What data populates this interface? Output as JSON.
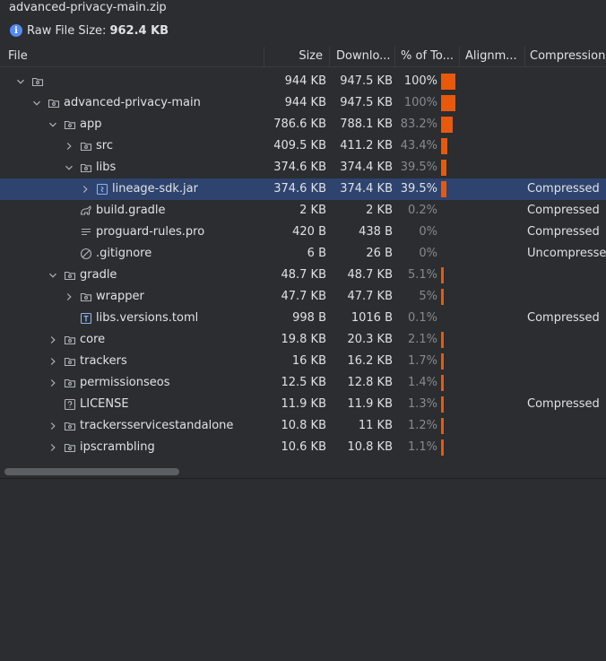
{
  "window": {
    "title": "advanced-privacy-main.zip"
  },
  "summary": {
    "raw_label": "Raw File Size:",
    "raw_value": "962.4 KB",
    "icon": "info-icon"
  },
  "columns": [
    {
      "label": "File"
    },
    {
      "label": "Size"
    },
    {
      "label": "Downlo..."
    },
    {
      "label": "% of To..."
    },
    {
      "label": "Alignm..."
    },
    {
      "label": "Compression"
    }
  ],
  "colors": {
    "bar": "#e8590c",
    "selected": "#2e436e",
    "background": "#2b2d30"
  },
  "rows": [
    {
      "depth": 0,
      "expand": "open",
      "icon": "folder-icon",
      "name": "",
      "size": "944 KB",
      "download": "947.5 KB",
      "percent": "100%",
      "fraction": 1.0,
      "compression": "",
      "emph": true
    },
    {
      "depth": 1,
      "expand": "open",
      "icon": "folder-icon",
      "name": "advanced-privacy-main",
      "size": "944 KB",
      "download": "947.5 KB",
      "percent": "100%",
      "fraction": 1.0,
      "compression": ""
    },
    {
      "depth": 2,
      "expand": "open",
      "icon": "folder-icon",
      "name": "app",
      "size": "786.6 KB",
      "download": "788.1 KB",
      "percent": "83.2%",
      "fraction": 0.832,
      "compression": ""
    },
    {
      "depth": 3,
      "expand": "closed",
      "icon": "folder-icon",
      "name": "src",
      "size": "409.5 KB",
      "download": "411.2 KB",
      "percent": "43.4%",
      "fraction": 0.434,
      "compression": ""
    },
    {
      "depth": 3,
      "expand": "open",
      "icon": "folder-icon",
      "name": "libs",
      "size": "374.6 KB",
      "download": "374.4 KB",
      "percent": "39.5%",
      "fraction": 0.395,
      "compression": ""
    },
    {
      "depth": 4,
      "expand": "closed",
      "icon": "jar-icon",
      "name": "lineage-sdk.jar",
      "size": "374.6 KB",
      "download": "374.4 KB",
      "percent": "39.5%",
      "fraction": 0.395,
      "compression": "Compressed",
      "selected": true
    },
    {
      "depth": 3,
      "expand": "none",
      "icon": "gradle-icon",
      "name": "build.gradle",
      "size": "2 KB",
      "download": "2 KB",
      "percent": "0.2%",
      "fraction": 0.002,
      "compression": "Compressed"
    },
    {
      "depth": 3,
      "expand": "none",
      "icon": "text-file-icon",
      "name": "proguard-rules.pro",
      "size": "420 B",
      "download": "438 B",
      "percent": "0%",
      "fraction": 0,
      "compression": "Compressed"
    },
    {
      "depth": 3,
      "expand": "none",
      "icon": "ignore-icon",
      "name": ".gitignore",
      "size": "6 B",
      "download": "26 B",
      "percent": "0%",
      "fraction": 0,
      "compression": "Uncompressed"
    },
    {
      "depth": 2,
      "expand": "open",
      "icon": "folder-icon",
      "name": "gradle",
      "size": "48.7 KB",
      "download": "48.7 KB",
      "percent": "5.1%",
      "fraction": 0.051,
      "compression": ""
    },
    {
      "depth": 3,
      "expand": "closed",
      "icon": "folder-icon",
      "name": "wrapper",
      "size": "47.7 KB",
      "download": "47.7 KB",
      "percent": "5%",
      "fraction": 0.05,
      "compression": ""
    },
    {
      "depth": 3,
      "expand": "none",
      "icon": "toml-icon",
      "name": "libs.versions.toml",
      "size": "998 B",
      "download": "1016 B",
      "percent": "0.1%",
      "fraction": 0.001,
      "compression": "Compressed"
    },
    {
      "depth": 2,
      "expand": "closed",
      "icon": "folder-icon",
      "name": "core",
      "size": "19.8 KB",
      "download": "20.3 KB",
      "percent": "2.1%",
      "fraction": 0.021,
      "compression": ""
    },
    {
      "depth": 2,
      "expand": "closed",
      "icon": "folder-icon",
      "name": "trackers",
      "size": "16 KB",
      "download": "16.2 KB",
      "percent": "1.7%",
      "fraction": 0.017,
      "compression": ""
    },
    {
      "depth": 2,
      "expand": "closed",
      "icon": "folder-icon",
      "name": "permissionseos",
      "size": "12.5 KB",
      "download": "12.8 KB",
      "percent": "1.4%",
      "fraction": 0.014,
      "compression": ""
    },
    {
      "depth": 2,
      "expand": "none",
      "icon": "unknown-file-icon",
      "name": "LICENSE",
      "size": "11.9 KB",
      "download": "11.9 KB",
      "percent": "1.3%",
      "fraction": 0.013,
      "compression": "Compressed"
    },
    {
      "depth": 2,
      "expand": "closed",
      "icon": "folder-icon",
      "name": "trackersservicestandalone",
      "size": "10.8 KB",
      "download": "11 KB",
      "percent": "1.2%",
      "fraction": 0.012,
      "compression": ""
    },
    {
      "depth": 2,
      "expand": "closed",
      "icon": "folder-icon",
      "name": "ipscrambling",
      "size": "10.6 KB",
      "download": "10.8 KB",
      "percent": "1.1%",
      "fraction": 0.011,
      "compression": ""
    }
  ]
}
